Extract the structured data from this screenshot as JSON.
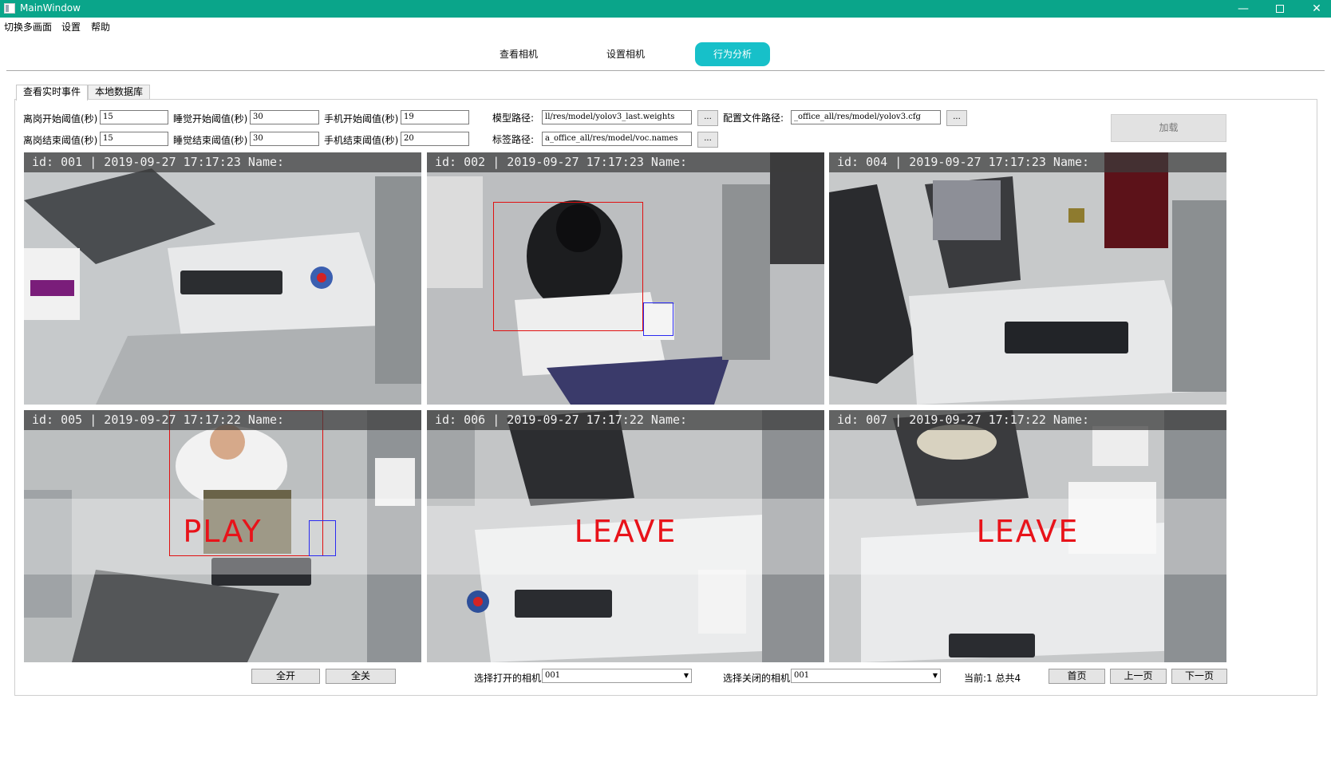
{
  "window": {
    "title": "MainWindow",
    "minimize": "—",
    "close": "✕"
  },
  "menu": [
    "切换多画面",
    "设置",
    "帮助"
  ],
  "top_tabs": [
    {
      "label": "查看相机",
      "active": false
    },
    {
      "label": "设置相机",
      "active": false
    },
    {
      "label": "行为分析",
      "active": true
    }
  ],
  "sub_tabs": [
    {
      "label": "查看实时事件",
      "active": true
    },
    {
      "label": "本地数据库",
      "active": false
    }
  ],
  "thresholds": {
    "leave_start_label": "离岗开始阈值(秒)",
    "leave_start_value": "15",
    "leave_end_label": "离岗结束阈值(秒)",
    "leave_end_value": "15",
    "sleep_start_label": "睡觉开始阈值(秒)",
    "sleep_start_value": "30",
    "sleep_end_label": "睡觉结束阈值(秒)",
    "sleep_end_value": "30",
    "phone_start_label": "手机开始阈值(秒)",
    "phone_start_value": "19",
    "phone_end_label": "手机结束阈值(秒)",
    "phone_end_value": "20"
  },
  "paths": {
    "model_label": "模型路径:",
    "model_value": "ll/res/model/yolov3_last.weights",
    "config_label": "配置文件路径:",
    "config_value": "_office_all/res/model/yolov3.cfg",
    "tag_label": "标签路径:",
    "tag_value": "a_office_all/res/model/voc.names",
    "browse": "..."
  },
  "load_button": "加载",
  "cameras": [
    {
      "overlay": "id: 001 | 2019-09-27 17:17:23 Name:",
      "status": "",
      "tone": "#bfc3c6"
    },
    {
      "overlay": "id: 002 | 2019-09-27 17:17:23 Name:",
      "status": "",
      "tone": "#b7b9bb"
    },
    {
      "overlay": "id: 004 | 2019-09-27 17:17:23 Name:",
      "status": "",
      "tone": "#c2c4c5"
    },
    {
      "overlay": "id: 005 | 2019-09-27 17:17:22 Name:",
      "status": "PLAY",
      "tone": "#b9bcbd"
    },
    {
      "overlay": "id: 006 | 2019-09-27 17:17:22 Name:",
      "status": "LEAVE",
      "tone": "#c4c6c7"
    },
    {
      "overlay": "id: 007 | 2019-09-27 17:17:22 Name:",
      "status": "LEAVE",
      "tone": "#c6c8c9"
    }
  ],
  "bottom": {
    "open_all": "全开",
    "close_all": "全关",
    "select_open_label": "选择打开的相机",
    "select_open_value": "001",
    "select_close_label": "选择关闭的相机",
    "select_close_value": "001",
    "page_info": "当前:1 总共4",
    "first_page": "首页",
    "prev_page": "上一页",
    "next_page": "下一页"
  },
  "colors": {
    "titlebar": "#0aa58a",
    "active_tab": "#17c0c9",
    "status_text": "#e8131a"
  }
}
